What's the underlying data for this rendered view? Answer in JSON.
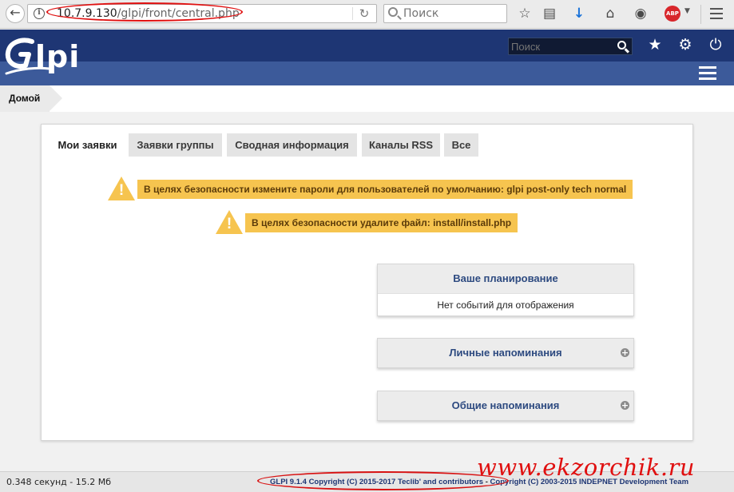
{
  "browser": {
    "url_host": "10.7.9.130",
    "url_path": "/glpi/front/central.php",
    "search_placeholder": "Поиск",
    "abp_label": "ABP"
  },
  "header": {
    "logo_text": "lpi",
    "search_placeholder": "Поиск"
  },
  "breadcrumb": {
    "home": "Домой"
  },
  "tabs": [
    {
      "label": "Мои заявки",
      "active": true
    },
    {
      "label": "Заявки группы",
      "active": false
    },
    {
      "label": "Сводная информация",
      "active": false
    },
    {
      "label": "Каналы RSS",
      "active": false
    },
    {
      "label": "Все",
      "active": false
    }
  ],
  "warnings": [
    "В целях безопасности измените пароли для пользователей по умолчанию: glpi post-only tech normal",
    "В целях безопасности удалите файл: install/install.php"
  ],
  "boxes": {
    "planning": {
      "title": "Ваше планирование",
      "body": "Нет событий для отображения"
    },
    "personal_reminders": {
      "title": "Личные напоминания"
    },
    "public_reminders": {
      "title": "Общие напоминания"
    }
  },
  "footer": {
    "timing": "0.348 секунд - 15.2 Мб",
    "copyright_glpi": "GLPI 9.1.4 Copyright (C) 2015-2017 Teclib' and contributors",
    "copyright_sep": " - ",
    "copyright_indepnet": "Copyright (C) 2003-2015 INDEPNET Development Team"
  },
  "watermark": "www.ekzorchik.ru",
  "colors": {
    "header_dark": "#1e3674",
    "header_band": "#3c5a9a",
    "warning": "#f6c44f",
    "annotation_red": "#e01010"
  },
  "icons": {
    "back": "back-arrow-icon",
    "info": "info-icon",
    "reload": "reload-icon",
    "bookmark": "bookmark-star-icon",
    "reading_list": "reading-list-icon",
    "download": "download-icon",
    "home": "home-icon",
    "pocket": "pocket-icon",
    "glpi_favorite": "star-icon",
    "glpi_settings": "gear-icon",
    "glpi_logout": "power-icon"
  }
}
